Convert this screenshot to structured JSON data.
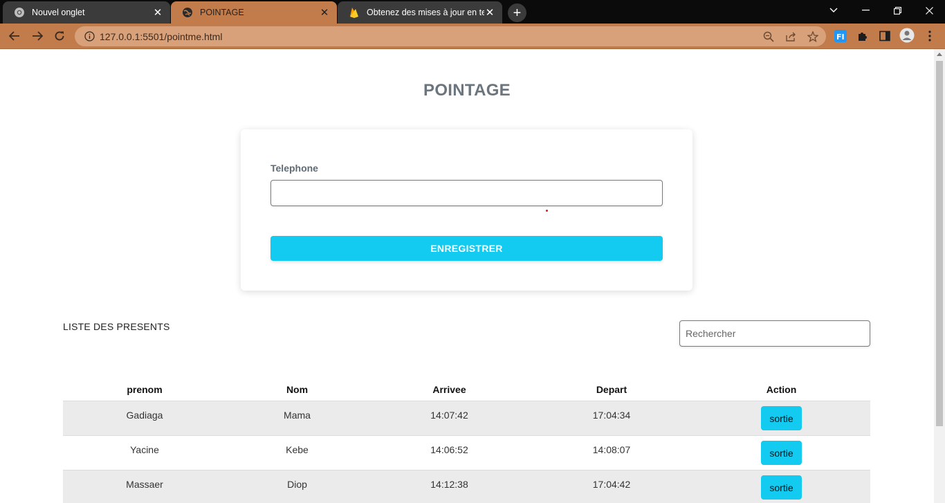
{
  "browser": {
    "tabs": [
      {
        "title": "Nouvel onglet",
        "icon": "chrome-icon"
      },
      {
        "title": "POINTAGE",
        "icon": "globe-icon"
      },
      {
        "title": "Obtenez des mises à jour en temps",
        "icon": "firebase-icon"
      }
    ],
    "url": "127.0.0.1:5501/pointme.html"
  },
  "page": {
    "title": "POINTAGE",
    "form": {
      "phone_label": "Telephone",
      "phone_value": "",
      "submit_label": "ENREGISTRER"
    },
    "list": {
      "title": "LISTE DES PRESENTS",
      "search_placeholder": "Rechercher",
      "columns": [
        "prenom",
        "Nom",
        "Arrivee",
        "Depart",
        "Action"
      ],
      "rows": [
        {
          "prenom": "Gadiaga",
          "nom": "Mama",
          "arrivee": "14:07:42",
          "depart": "17:04:34",
          "action": "sortie"
        },
        {
          "prenom": "Yacine",
          "nom": "Kebe",
          "arrivee": "14:06:52",
          "depart": "14:08:07",
          "action": "sortie"
        },
        {
          "prenom": "Massaer",
          "nom": "Diop",
          "arrivee": "14:12:38",
          "depart": "17:04:42",
          "action": "sortie"
        }
      ]
    }
  },
  "colors": {
    "accent": "#13caf0",
    "toolbar": "#c27c4c",
    "title": "#6c757d"
  }
}
